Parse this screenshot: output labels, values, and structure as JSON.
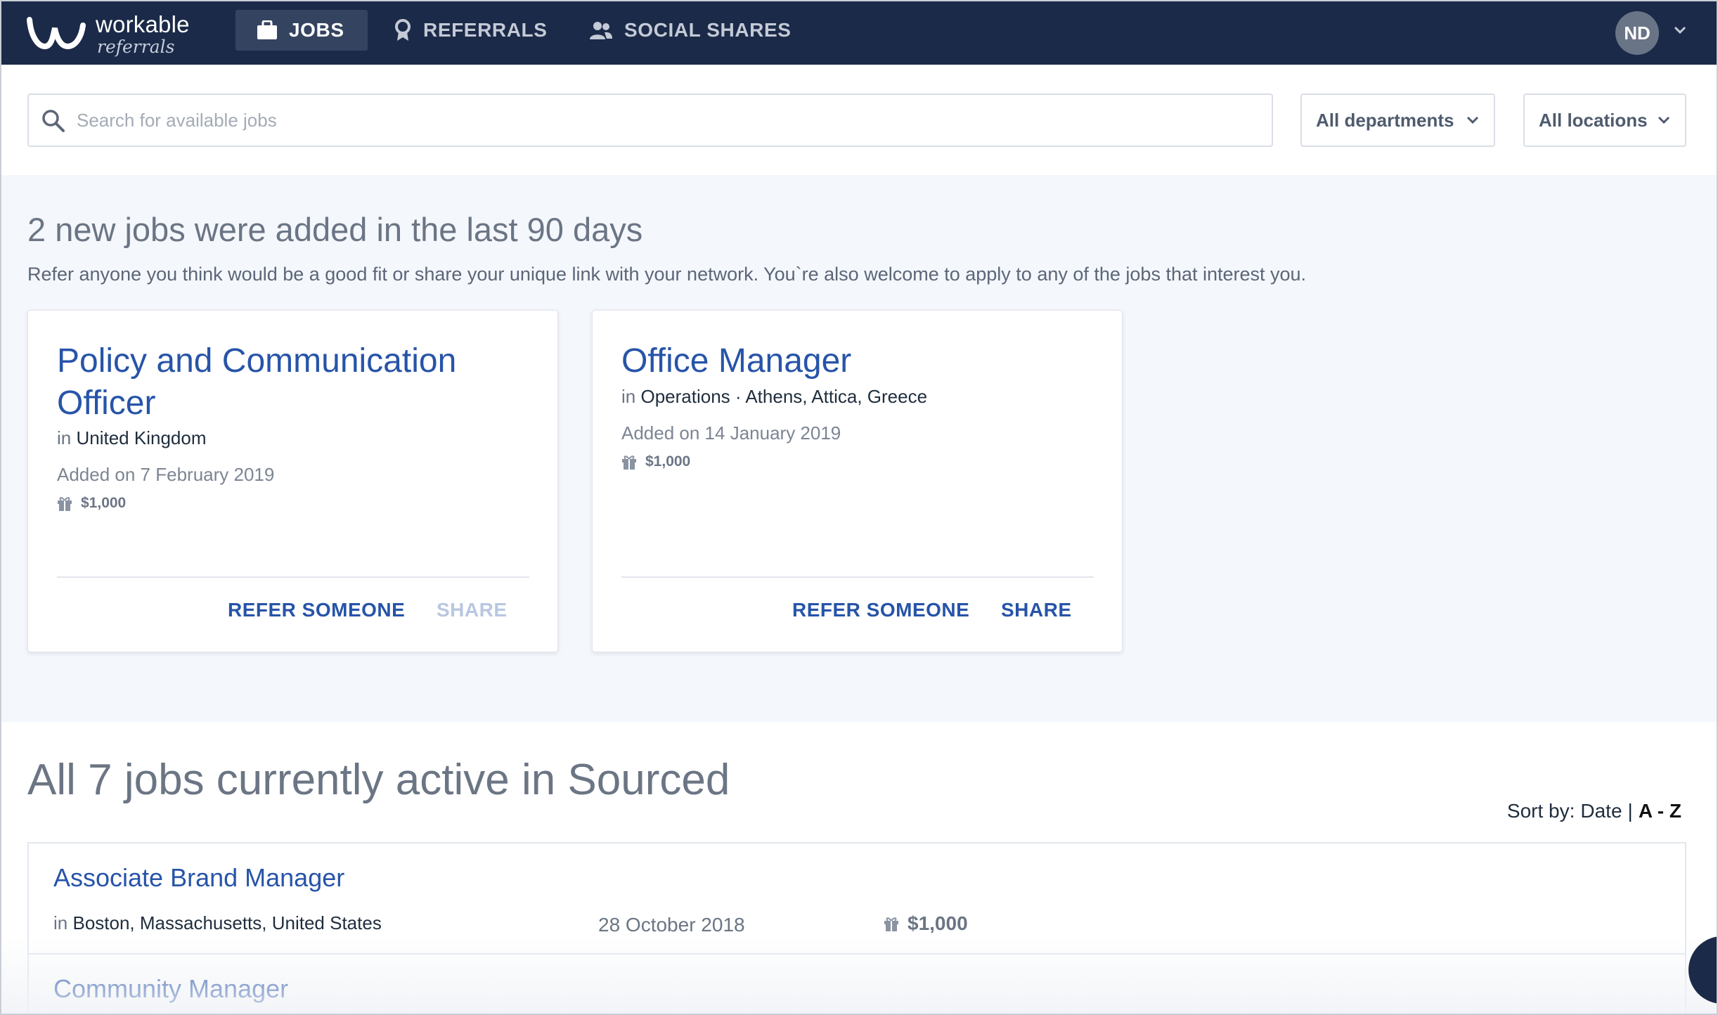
{
  "brand": {
    "word": "workable",
    "sub": "referrals"
  },
  "nav": {
    "items": [
      {
        "label": "JOBS",
        "icon": "briefcase-icon",
        "active": true
      },
      {
        "label": "REFERRALS",
        "icon": "award-icon",
        "active": false
      },
      {
        "label": "SOCIAL SHARES",
        "icon": "users-icon",
        "active": false
      }
    ],
    "user_initials": "ND"
  },
  "filters": {
    "search_placeholder": "Search for available jobs",
    "search_value": "",
    "department": "All departments",
    "location": "All locations"
  },
  "new_jobs": {
    "title": "2 new jobs were added in the last 90 days",
    "description": "Refer anyone you think would be a good fit or share your unique link with your network. You`re also welcome to apply to any of the jobs that interest you.",
    "cards": [
      {
        "title": "Policy and Communication Officer",
        "in_prefix": "in",
        "location": "United Kingdom",
        "added": "Added on 7 February 2019",
        "bonus": "$1,000",
        "refer_label": "REFER SOMEONE",
        "share_label": "SHARE",
        "share_enabled": false
      },
      {
        "title": "Office Manager",
        "in_prefix": "in",
        "location": "Operations · Athens, Attica, Greece",
        "added": "Added on 14 January 2019",
        "bonus": "$1,000",
        "refer_label": "REFER SOMEONE",
        "share_label": "SHARE",
        "share_enabled": true
      }
    ]
  },
  "all_jobs": {
    "title": "All 7 jobs currently active in Sourced",
    "sort_label": "Sort by:",
    "sort_date": "Date",
    "sort_separator": "|",
    "sort_az": "A - Z",
    "rows": [
      {
        "title": "Associate Brand Manager",
        "in_prefix": "in",
        "location": "Boston, Massachusetts, United States",
        "date": "28 October 2018",
        "bonus": "$1,000"
      },
      {
        "title": "Community Manager"
      }
    ]
  },
  "colors": {
    "topbar": "#1b2a48",
    "link": "#2754a8",
    "band": "#f4f7fc"
  }
}
